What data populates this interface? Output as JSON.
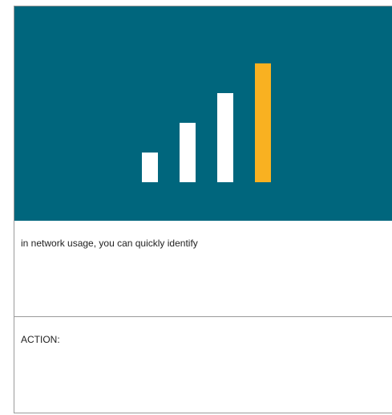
{
  "hero": {
    "icon": "signal-strength-icon",
    "background_color": "#00667d",
    "bars": [
      {
        "level": 0.25,
        "color": "#ffffff"
      },
      {
        "level": 0.5,
        "color": "#ffffff"
      },
      {
        "level": 0.75,
        "color": "#ffffff"
      },
      {
        "level": 1.0,
        "color": "#f9b121"
      }
    ]
  },
  "body": {
    "description": "in network usage, you can quickly identify",
    "action_label": "ACTION:"
  }
}
